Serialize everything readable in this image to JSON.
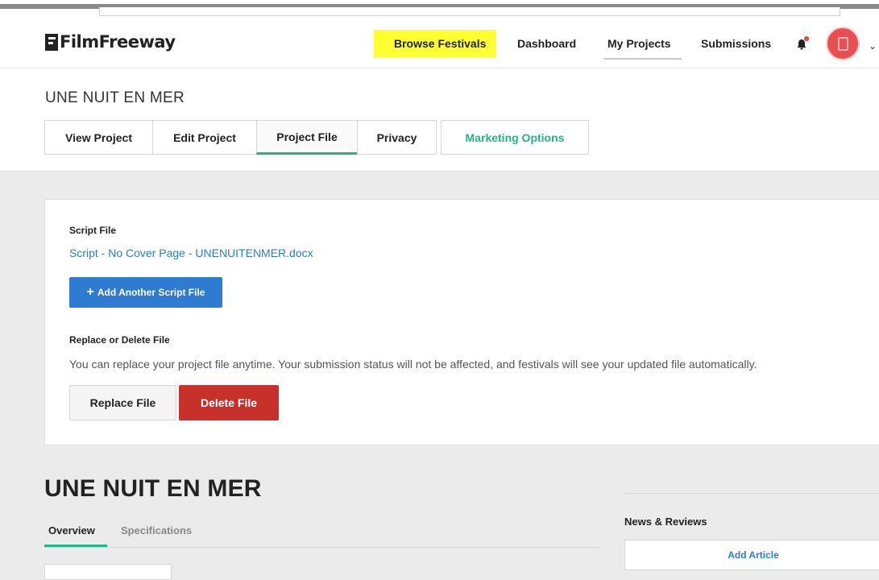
{
  "app": {
    "name": "FilmFreeway"
  },
  "nav": {
    "browse": "Browse Festivals",
    "dashboard": "Dashboard",
    "my_projects": "My Projects",
    "submissions": "Submissions"
  },
  "project": {
    "title": "UNE NUIT EN MER",
    "tabs": [
      "View Project",
      "Edit Project",
      "Project File",
      "Privacy",
      "Marketing Options"
    ],
    "active_tab": "Project File"
  },
  "file_card": {
    "script_label": "Script File",
    "file_name": "Script - No Cover Page - UNENUITENMER.docx",
    "add_button": "Add Another Script File",
    "replace_heading": "Replace or Delete File",
    "description": "You can replace your project file anytime. Your submission status will not be affected, and festivals will see your updated file automatically.",
    "replace_button": "Replace File",
    "delete_button": "Delete File"
  },
  "overview": {
    "title": "UNE NUIT EN MER",
    "tabs": [
      "Overview",
      "Specifications"
    ]
  },
  "sidebar": {
    "news_heading": "News & Reviews",
    "add_article": "Add Article"
  },
  "colors": {
    "accent_green": "#20b486",
    "primary_blue": "#2f7bd1",
    "danger_red": "#c8302c",
    "highlight_yellow": "#ffff33"
  }
}
